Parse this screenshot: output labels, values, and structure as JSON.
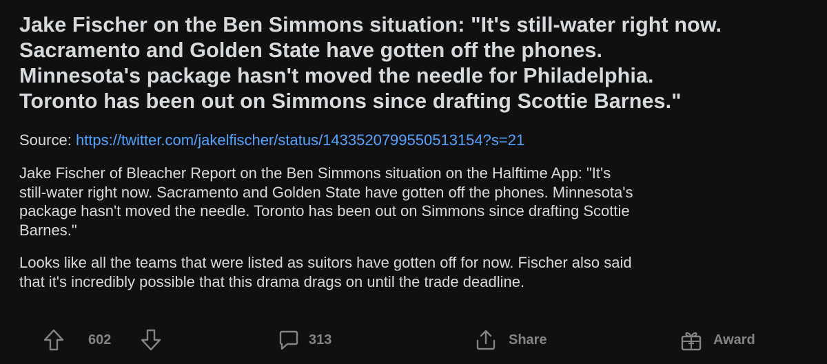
{
  "post": {
    "title_lines": [
      "Jake Fischer on the Ben Simmons situation: \"It's still-water right now.",
      "Sacramento and Golden State have gotten off the phones.",
      "Minnesota's package hasn't moved the needle for Philadelphia.",
      "Toronto has been out on Simmons since drafting Scottie Barnes.\""
    ],
    "source_label": "Source: ",
    "source_url": "https://twitter.com/jakelfischer/status/1433520799550513154?s=21",
    "paragraph1_lines": [
      "Jake Fischer of Bleacher Report on the Ben Simmons situation on the Halftime App: \"It's",
      "still-water right now. Sacramento and Golden State have gotten off the phones. Minnesota's",
      "package hasn't moved the needle. Toronto has been out on Simmons since drafting Scottie",
      "Barnes.\""
    ],
    "paragraph2_lines": [
      "Looks like all the teams that were listed as suitors have gotten off for now. Fischer also said",
      "that it's incredibly possible that this drama drags on until the trade deadline."
    ]
  },
  "actions": {
    "upvote_icon": "upvote-arrow-icon",
    "vote_count": "602",
    "downvote_icon": "downvote-arrow-icon",
    "comment_icon": "comment-bubble-icon",
    "comment_count": "313",
    "share_icon": "share-icon",
    "share_label": "Share",
    "award_icon": "award-gift-icon",
    "award_label": "Award"
  },
  "colors": {
    "background": "#101011",
    "text": "#d7dadc",
    "link": "#4fa3ff",
    "muted": "#818384"
  }
}
